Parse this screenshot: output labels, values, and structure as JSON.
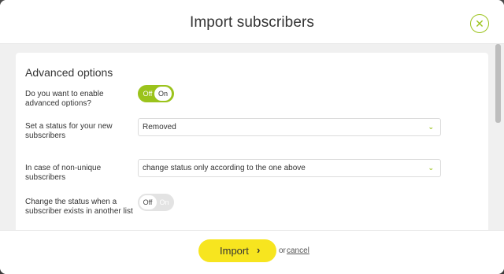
{
  "modal": {
    "title": "Import subscribers",
    "close_icon": "close-icon"
  },
  "section": {
    "title": "Advanced options"
  },
  "rows": {
    "advanced": {
      "label": "Do you want to enable advanced options?",
      "toggle": {
        "off_label": "Off",
        "on_label": "On",
        "state": "on"
      }
    },
    "status": {
      "label": "Set a status for your new subscribers",
      "value": "Removed"
    },
    "nonunique": {
      "label": "In case of non-unique subscribers",
      "value": "change status only according to the one above"
    },
    "change_status": {
      "label": "Change the status when a subscriber exists in another list",
      "toggle": {
        "off_label": "Off",
        "on_label": "On",
        "state": "off"
      }
    }
  },
  "footer": {
    "import_label": "Import",
    "arrow": "›",
    "or_text": "or",
    "cancel_label": "cancel"
  },
  "colors": {
    "accent": "#9bc31c",
    "primary_button": "#f7e51f"
  },
  "icons": {
    "chevron": "chevron-down-icon"
  }
}
